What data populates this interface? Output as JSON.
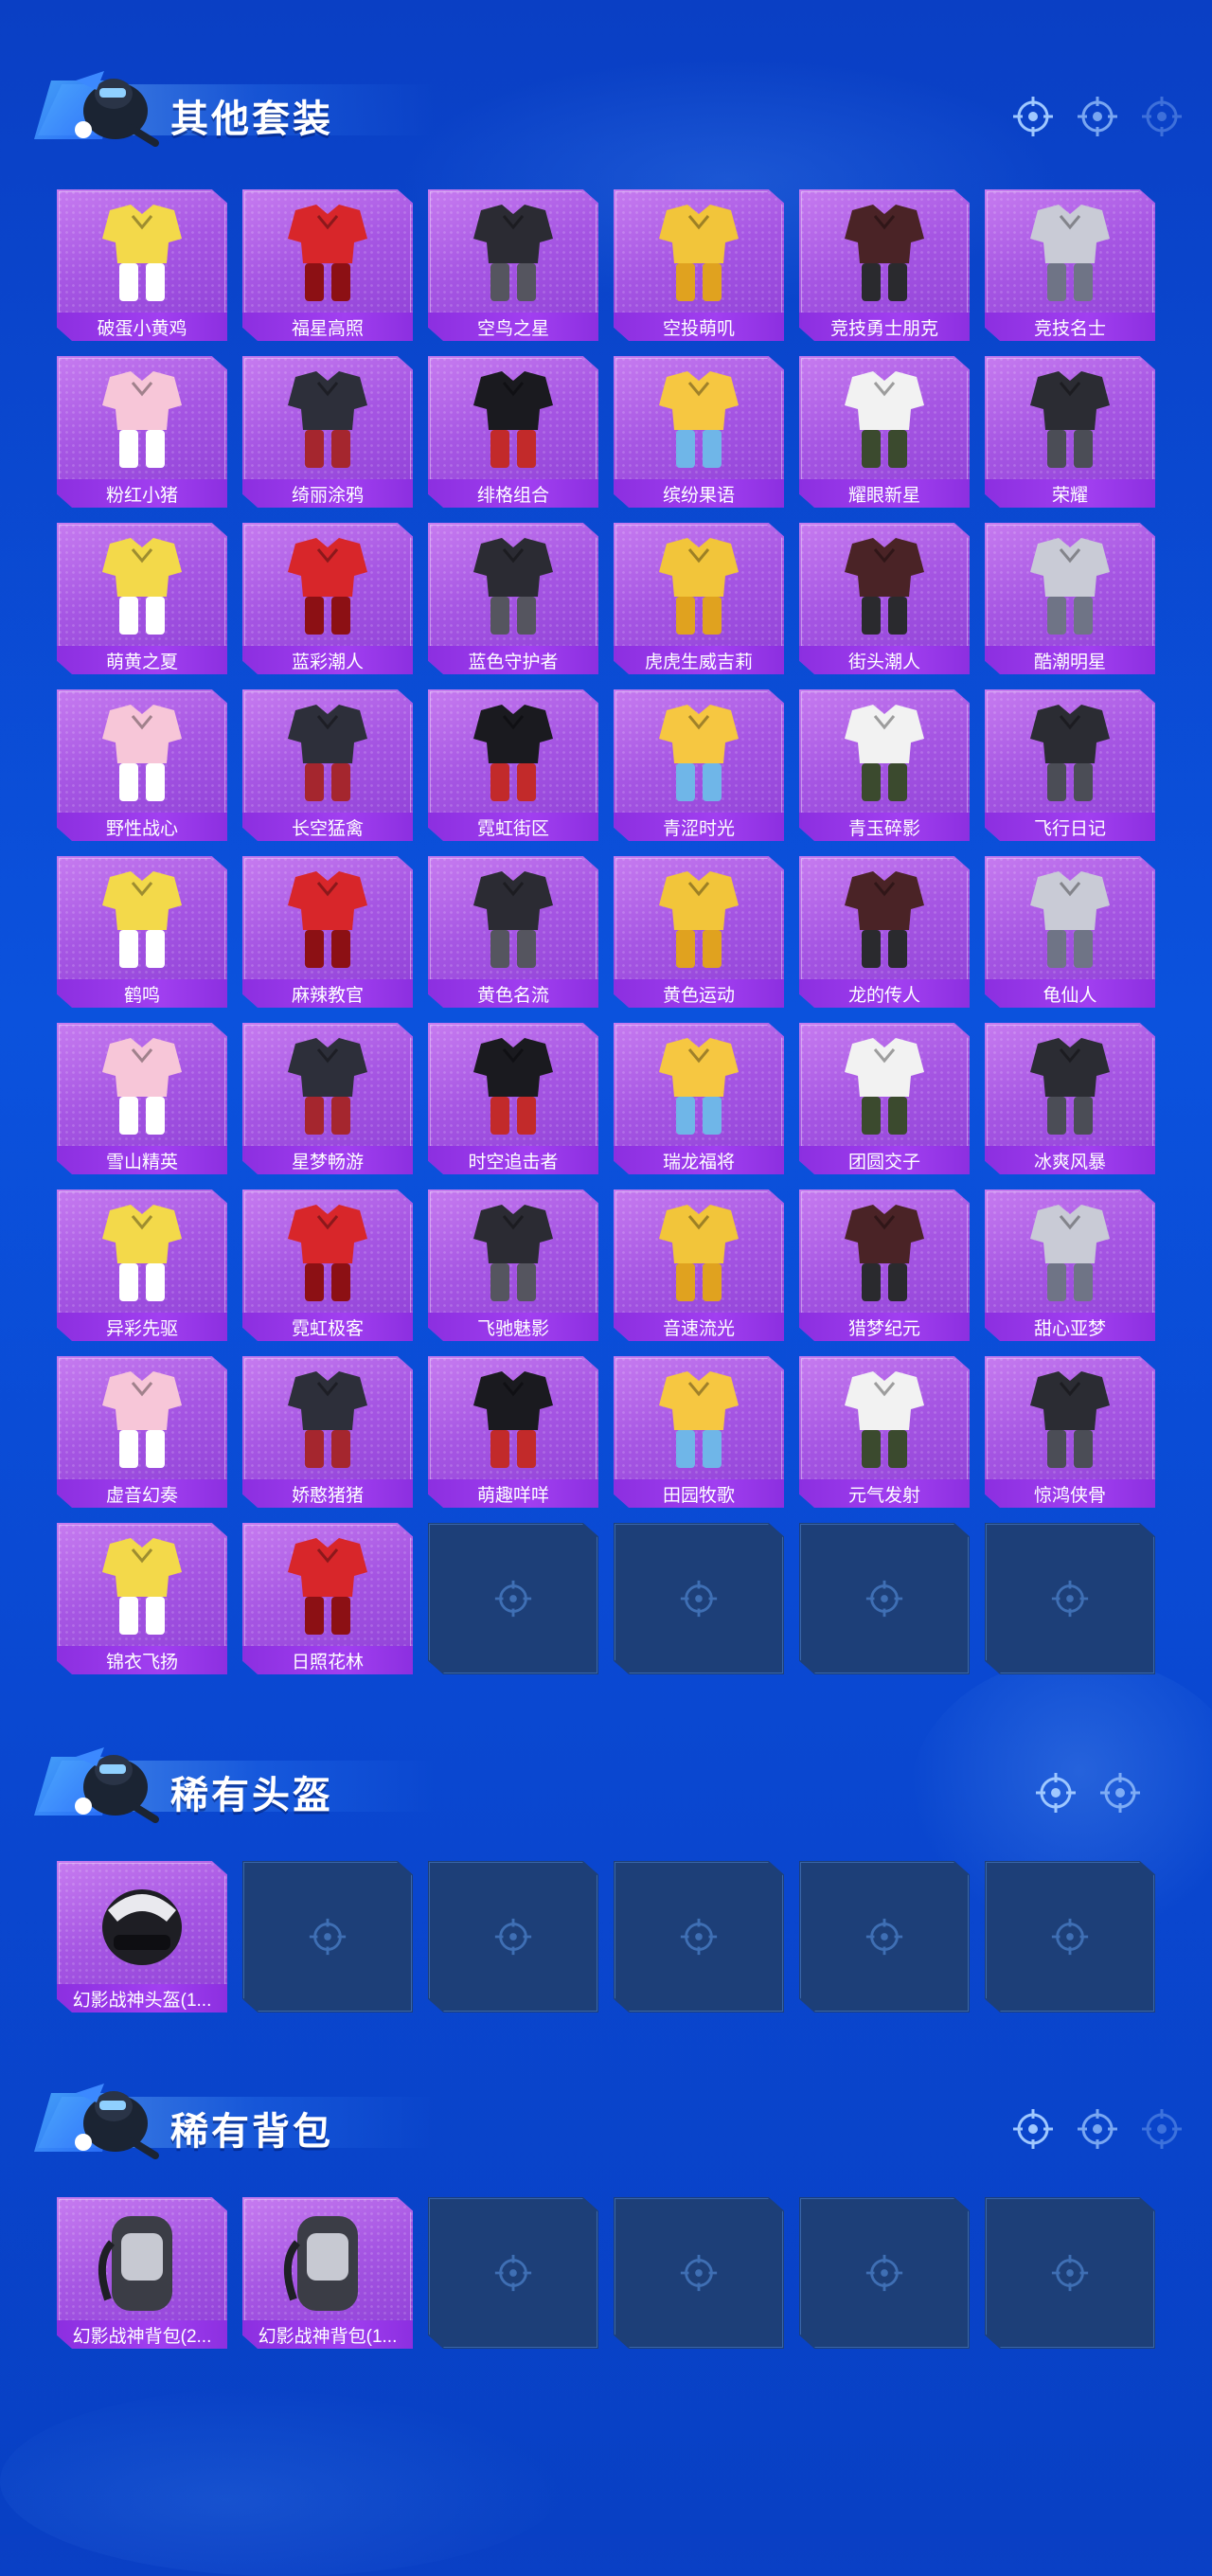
{
  "colors": {
    "background": "#0b4fd9",
    "card_purple": "#a656e3",
    "label_bar": "#9a38ea",
    "empty_slot": "#1d3f78"
  },
  "sections": [
    {
      "title": "其他套装",
      "header_icons": [
        "crosshair-icon",
        "crosshair-icon",
        "crosshair-icon"
      ],
      "items": [
        {
          "label": "破蛋小黄鸡"
        },
        {
          "label": "福星高照"
        },
        {
          "label": "空鸟之星"
        },
        {
          "label": "空投萌叽"
        },
        {
          "label": "竞技勇士朋克"
        },
        {
          "label": "竞技名士"
        },
        {
          "label": "粉红小猪"
        },
        {
          "label": "绮丽涂鸦"
        },
        {
          "label": "绯格组合"
        },
        {
          "label": "缤纷果语"
        },
        {
          "label": "耀眼新星"
        },
        {
          "label": "荣耀"
        },
        {
          "label": "萌黄之夏"
        },
        {
          "label": "蓝彩潮人"
        },
        {
          "label": "蓝色守护者"
        },
        {
          "label": "虎虎生威吉莉"
        },
        {
          "label": "街头潮人"
        },
        {
          "label": "酷潮明星"
        },
        {
          "label": "野性战心"
        },
        {
          "label": "长空猛禽"
        },
        {
          "label": "霓虹街区"
        },
        {
          "label": "青涩时光"
        },
        {
          "label": "青玉碎影"
        },
        {
          "label": "飞行日记"
        },
        {
          "label": "鹤鸣"
        },
        {
          "label": "麻辣教官"
        },
        {
          "label": "黄色名流"
        },
        {
          "label": "黄色运动"
        },
        {
          "label": "龙的传人"
        },
        {
          "label": "龟仙人"
        },
        {
          "label": "雪山精英"
        },
        {
          "label": "星梦畅游"
        },
        {
          "label": "时空追击者"
        },
        {
          "label": "瑞龙福将"
        },
        {
          "label": "团圆交子"
        },
        {
          "label": "冰爽风暴"
        },
        {
          "label": "异彩先驱"
        },
        {
          "label": "霓虹极客"
        },
        {
          "label": "飞驰魅影"
        },
        {
          "label": "音速流光"
        },
        {
          "label": "猎梦纪元"
        },
        {
          "label": "甜心亚梦"
        },
        {
          "label": "虚音幻奏"
        },
        {
          "label": "娇憨猪猪"
        },
        {
          "label": "萌趣咩咩"
        },
        {
          "label": "田园牧歌"
        },
        {
          "label": "元气发射"
        },
        {
          "label": "惊鸿侠骨"
        },
        {
          "label": "锦衣飞扬"
        },
        {
          "label": "日照花林"
        }
      ],
      "empty_slots": 4
    },
    {
      "title": "稀有头盔",
      "header_icons": [
        "crosshair-icon",
        "crosshair-icon"
      ],
      "items": [
        {
          "label": "幻影战神头盔(1..."
        }
      ],
      "empty_slots": 5
    },
    {
      "title": "稀有背包",
      "header_icons": [
        "crosshair-icon",
        "crosshair-icon",
        "crosshair-icon"
      ],
      "items": [
        {
          "label": "幻影战神背包(2..."
        },
        {
          "label": "幻影战神背包(1..."
        }
      ],
      "empty_slots": 4
    }
  ]
}
